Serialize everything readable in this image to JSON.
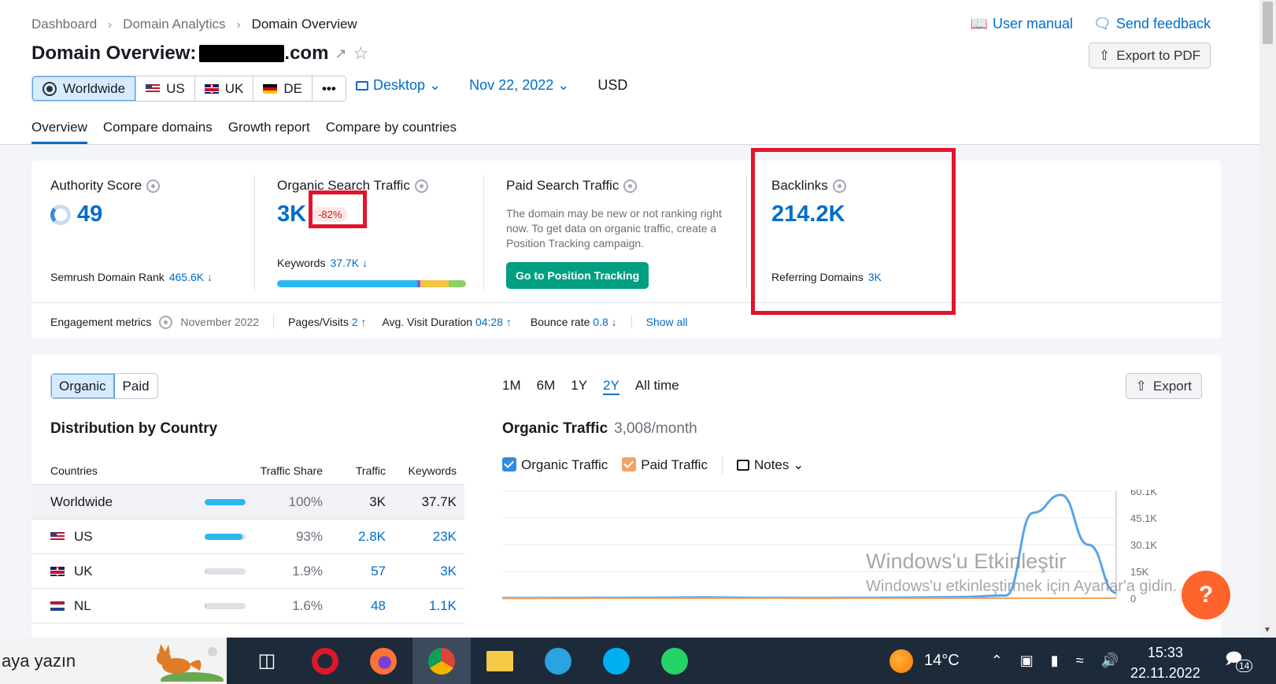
{
  "breadcrumb": [
    "Dashboard",
    "Domain Analytics",
    "Domain Overview"
  ],
  "top_links": {
    "manual": "User manual",
    "feedback": "Send feedback"
  },
  "title": {
    "prefix": "Domain Overview:",
    "domain_suffix": ".com"
  },
  "export_pdf": "Export to PDF",
  "databases": [
    {
      "label": "Worldwide",
      "flag": "globe"
    },
    {
      "label": "US",
      "flag": "us"
    },
    {
      "label": "UK",
      "flag": "uk"
    },
    {
      "label": "DE",
      "flag": "de"
    },
    {
      "label": "•••",
      "flag": "more"
    }
  ],
  "device": "Desktop",
  "date": "Nov 22, 2022",
  "currency": "USD",
  "tabs": [
    "Overview",
    "Compare domains",
    "Growth report",
    "Compare by countries"
  ],
  "metrics": {
    "authority": {
      "label": "Authority Score",
      "value": "49",
      "sub_label": "Semrush Domain Rank",
      "sub_value": "465.6K ↓"
    },
    "organic": {
      "label": "Organic Search Traffic",
      "value": "3K",
      "badge": "-82%",
      "sub_label": "Keywords",
      "sub_value": "37.7K ↓"
    },
    "paid": {
      "label": "Paid Search Traffic",
      "desc": "The domain may be new or not ranking right now. To get data on organic traffic, create a Position Tracking campaign.",
      "button": "Go to Position Tracking"
    },
    "backlinks": {
      "label": "Backlinks",
      "value": "214.2K",
      "sub_label": "Referring Domains",
      "sub_value": "3K"
    }
  },
  "keyword_bar": [
    {
      "share": 0.74,
      "color": "#2bb7f0"
    },
    {
      "share": 0.02,
      "color": "#8e5be0"
    },
    {
      "share": 0.15,
      "color": "#f4c542"
    },
    {
      "share": 0.09,
      "color": "#8bd163"
    }
  ],
  "engagement": {
    "label": "Engagement metrics",
    "month": "November 2022",
    "pages_label": "Pages/Visits",
    "pages_value": "2 ↑",
    "duration_label": "Avg. Visit Duration",
    "duration_value": "04:28 ↑",
    "bounce_label": "Bounce rate",
    "bounce_value": "0.8 ↓",
    "show_all": "Show all"
  },
  "segment": [
    "Organic",
    "Paid"
  ],
  "distribution": {
    "title": "Distribution by Country",
    "headers": [
      "Countries",
      "Traffic Share",
      "Traffic",
      "Keywords"
    ],
    "rows": [
      {
        "country": "Worldwide",
        "flag": "none",
        "share": "100%",
        "share_fraction": 1.0,
        "traffic": "3K",
        "keywords": "37.7K"
      },
      {
        "country": "US",
        "flag": "us",
        "share": "93%",
        "share_fraction": 0.93,
        "traffic": "2.8K",
        "keywords": "23K"
      },
      {
        "country": "UK",
        "flag": "uk",
        "share": "1.9%",
        "share_fraction": 0.019,
        "traffic": "57",
        "keywords": "3K"
      },
      {
        "country": "NL",
        "flag": "nl",
        "share": "1.6%",
        "share_fraction": 0.016,
        "traffic": "48",
        "keywords": "1.1K"
      }
    ]
  },
  "periods": [
    "1M",
    "6M",
    "1Y",
    "2Y",
    "All time"
  ],
  "active_period": "2Y",
  "export": "Export",
  "organic_traffic": {
    "title": "Organic Traffic",
    "rate": "3,008/month"
  },
  "legend": {
    "organic": "Organic Traffic",
    "paid": "Paid Traffic",
    "notes": "Notes"
  },
  "colors": {
    "organic": "#5aa3e8",
    "paid": "#f4a261",
    "brand_blue": "#006dca",
    "highlight": "#e3142c",
    "green": "#009f81",
    "help": "#ff642d"
  },
  "chart_data": {
    "type": "line",
    "series": [
      {
        "name": "Organic Traffic",
        "values": [
          100,
          150,
          200,
          300,
          500,
          250,
          180,
          200,
          400,
          600,
          1500,
          48000,
          58000,
          30000,
          3000
        ]
      },
      {
        "name": "Paid Traffic",
        "values": [
          0,
          0,
          0,
          0,
          0,
          0,
          0,
          0,
          0,
          0,
          0,
          0,
          0,
          0,
          0
        ]
      }
    ],
    "y_ticks": [
      "60.1K",
      "45.1K",
      "30.1K",
      "15K",
      "0"
    ],
    "ylim": [
      0,
      60100
    ],
    "grid": true
  },
  "watermark": {
    "line1": "Windows'u Etkinleştir",
    "line2": "Windows'u etkinleştirmek için Ayarlar'a gidin."
  },
  "help": "?",
  "taskbar": {
    "search": "aya yazın",
    "weather": "14°C",
    "time": "15:33",
    "date": "22.11.2022",
    "notifications": "14"
  }
}
